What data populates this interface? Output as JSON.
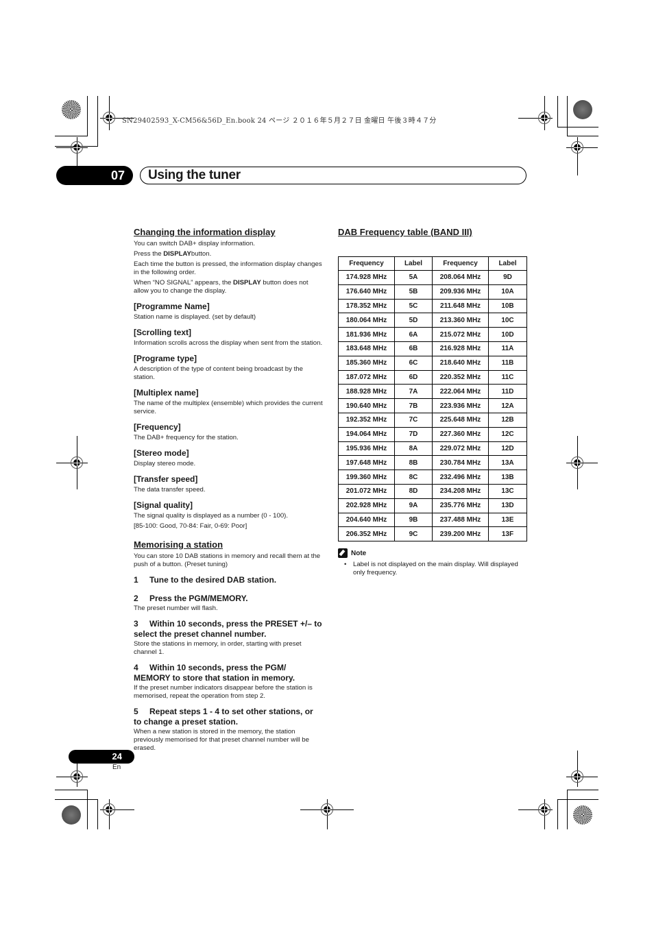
{
  "print_header": "SN29402593_X-CM56&56D_En.book  24 ページ  ２０１６年５月２７日  金曜日  午後３時４７分",
  "chapter": {
    "number": "07",
    "title": "Using the tuner"
  },
  "left": {
    "section1": {
      "title": "Changing the information display",
      "intro": "You can switch DAB+ display information.",
      "press_prefix": "Press the ",
      "press_bold": "DISPLAY",
      "press_suffix": "button.",
      "order": "Each time the button is pressed, the information display changes in the following order.",
      "nosignal_prefix": "When “NO SIGNAL” appears, the ",
      "nosignal_bold": "DISPLAY",
      "nosignal_suffix": " button does not allow you to change the display.",
      "items": [
        {
          "title": "[Programme Name]",
          "desc": "Station name is displayed. (set by default)"
        },
        {
          "title": "[Scrolling text]",
          "desc": "Information scrolls across the display when sent from the station."
        },
        {
          "title": "[Programe type]",
          "desc": "A description of the type of content being broadcast by the station."
        },
        {
          "title": "[Multiplex name]",
          "desc": "The name of the multiplex (ensemble) which provides the current service."
        },
        {
          "title": "[Frequency]",
          "desc": "The DAB+ frequency for the station."
        },
        {
          "title": "[Stereo mode]",
          "desc": "Display stereo mode."
        },
        {
          "title": "[Transfer speed]",
          "desc": "The data transfer speed."
        },
        {
          "title": "[Signal quality]",
          "desc": "The signal quality is displayed as a number (0 - 100).",
          "extra": "[85-100: Good, 70-84: Fair, 0-69: Poor]"
        }
      ]
    },
    "section2": {
      "title": "Memorising a station",
      "intro": "You can store 10 DAB stations in memory and recall them at the push of a button. (Preset tuning)",
      "steps": [
        {
          "num": "1",
          "text": "Tune to the desired DAB station.",
          "desc": ""
        },
        {
          "num": "2",
          "text": "Press the PGM/MEMORY.",
          "desc": "The preset number will flash."
        },
        {
          "num": "3",
          "text": "Within 10 seconds, press the PRESET +/– to select the preset channel number.",
          "desc": "Store the stations in memory, in order, starting with preset channel 1."
        },
        {
          "num": "4",
          "text": "Within 10 seconds, press the PGM/ MEMORY to store that station in memory.",
          "desc": "If the preset number indicators disappear before the station is memorised, repeat the operation from step 2."
        },
        {
          "num": "5",
          "text": "Repeat steps 1 - 4 to set other stations, or to change a preset station.",
          "desc": "When a new station is stored in the memory, the station previously memorised for that preset channel number will be erased."
        }
      ]
    }
  },
  "right": {
    "title": "DAB Frequency table (BAND III)",
    "table": {
      "headers": [
        "Frequency",
        "Label",
        "Frequency",
        "Label"
      ],
      "rows": [
        [
          "174.928 MHz",
          "5A",
          "208.064 MHz",
          "9D"
        ],
        [
          "176.640 MHz",
          "5B",
          "209.936 MHz",
          "10A"
        ],
        [
          "178.352 MHz",
          "5C",
          "211.648 MHz",
          "10B"
        ],
        [
          "180.064 MHz",
          "5D",
          "213.360 MHz",
          "10C"
        ],
        [
          "181.936 MHz",
          "6A",
          "215.072 MHz",
          "10D"
        ],
        [
          "183.648 MHz",
          "6B",
          "216.928 MHz",
          "11A"
        ],
        [
          "185.360 MHz",
          "6C",
          "218.640 MHz",
          "11B"
        ],
        [
          "187.072 MHz",
          "6D",
          "220.352 MHz",
          "11C"
        ],
        [
          "188.928 MHz",
          "7A",
          "222.064 MHz",
          "11D"
        ],
        [
          "190.640 MHz",
          "7B",
          "223.936 MHz",
          "12A"
        ],
        [
          "192.352 MHz",
          "7C",
          "225.648 MHz",
          "12B"
        ],
        [
          "194.064 MHz",
          "7D",
          "227.360 MHz",
          "12C"
        ],
        [
          "195.936 MHz",
          "8A",
          "229.072 MHz",
          "12D"
        ],
        [
          "197.648 MHz",
          "8B",
          "230.784 MHz",
          "13A"
        ],
        [
          "199.360 MHz",
          "8C",
          "232.496 MHz",
          "13B"
        ],
        [
          "201.072 MHz",
          "8D",
          "234.208 MHz",
          "13C"
        ],
        [
          "202.928 MHz",
          "9A",
          "235.776 MHz",
          "13D"
        ],
        [
          "204.640 MHz",
          "9B",
          "237.488 MHz",
          "13E"
        ],
        [
          "206.352 MHz",
          "9C",
          "239.200 MHz",
          "13F"
        ]
      ]
    },
    "note": {
      "icon": "pencil-note-icon",
      "title": "Note",
      "items": [
        "Label is not displayed on the main display. Will displayed only frequency."
      ]
    }
  },
  "footer": {
    "page_number": "24",
    "language": "En"
  }
}
